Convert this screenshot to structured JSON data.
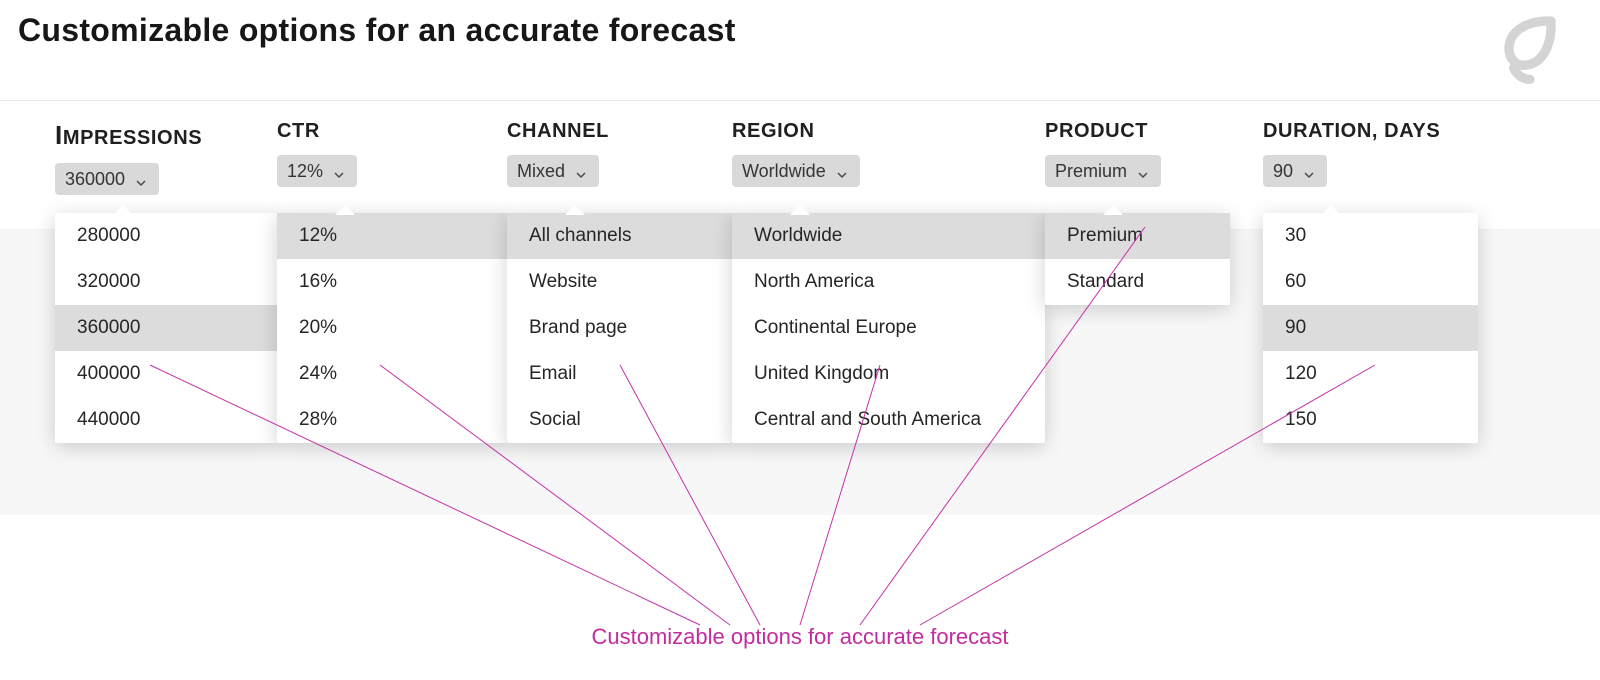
{
  "title": "Customizable options for an accurate forecast",
  "callout": "Customizable options for accurate forecast",
  "filters": {
    "impressions": {
      "label": "Impressions",
      "value": "360000",
      "options": [
        "280000",
        "320000",
        "360000",
        "400000",
        "440000"
      ]
    },
    "ctr": {
      "label": "CTR",
      "value": "12%",
      "options": [
        "12%",
        "16%",
        "20%",
        "24%",
        "28%"
      ]
    },
    "channel": {
      "label": "Channel",
      "value": "Mixed",
      "options": [
        "All channels",
        "Website",
        "Brand page",
        "Email",
        "Social"
      ]
    },
    "region": {
      "label": "Region",
      "value": "Worldwide",
      "options": [
        "Worldwide",
        "North America",
        "Continental Europe",
        "United Kingdom",
        "Central and South America"
      ]
    },
    "product": {
      "label": "Product",
      "value": "Premium",
      "options": [
        "Premium",
        "Standard"
      ]
    },
    "duration": {
      "label": "Duration, days",
      "value": "90",
      "options": [
        "30",
        "60",
        "90",
        "120",
        "150"
      ]
    }
  },
  "selected_option_highlight": {
    "impressions": "360000",
    "ctr": "12%",
    "channel": "All channels",
    "region": "Worldwide",
    "product": "Premium",
    "duration": "90"
  }
}
